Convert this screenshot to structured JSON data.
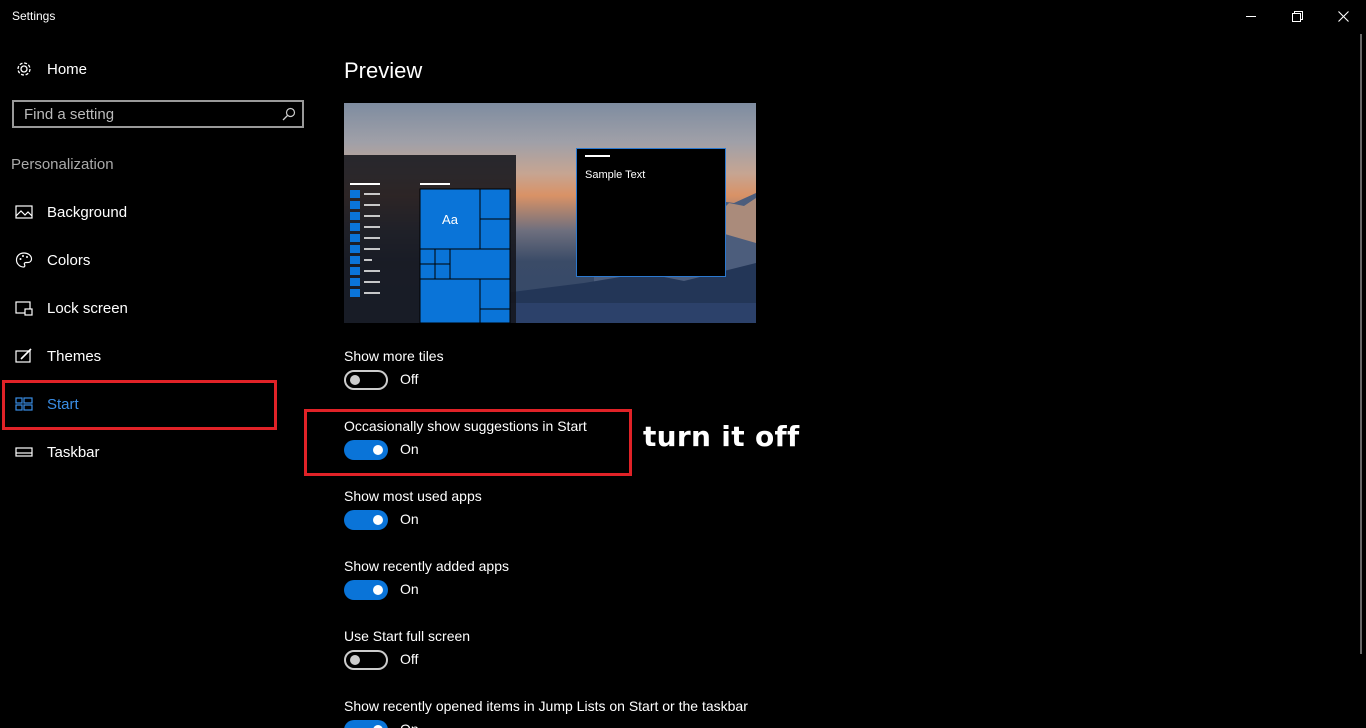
{
  "window": {
    "title": "Settings",
    "controls": {
      "minimize": "minimize",
      "maximize": "restore",
      "close": "close"
    }
  },
  "sidebar": {
    "home_label": "Home",
    "search_placeholder": "Find a setting",
    "section": "Personalization",
    "items": [
      {
        "label": "Background",
        "icon": "picture-icon"
      },
      {
        "label": "Colors",
        "icon": "palette-icon"
      },
      {
        "label": "Lock screen",
        "icon": "lock-screen-icon"
      },
      {
        "label": "Themes",
        "icon": "brush-icon"
      },
      {
        "label": "Start",
        "icon": "start-icon",
        "active": true
      },
      {
        "label": "Taskbar",
        "icon": "taskbar-icon"
      }
    ]
  },
  "main": {
    "preview_title": "Preview",
    "preview": {
      "tile_text": "Aa",
      "sample_text": "Sample Text"
    },
    "settings": [
      {
        "label": "Show more tiles",
        "state": "Off"
      },
      {
        "label": "Occasionally show suggestions in Start",
        "state": "On"
      },
      {
        "label": "Show most used apps",
        "state": "On"
      },
      {
        "label": "Show recently added apps",
        "state": "On"
      },
      {
        "label": "Use Start full screen",
        "state": "Off"
      },
      {
        "label": "Show recently opened items in Jump Lists on Start or the taskbar",
        "state": "On"
      }
    ]
  },
  "annotation": {
    "text": "turn it off"
  },
  "colors": {
    "accent": "#0a74d8",
    "highlight": "#e02227",
    "active_nav": "#3a8ee6"
  }
}
